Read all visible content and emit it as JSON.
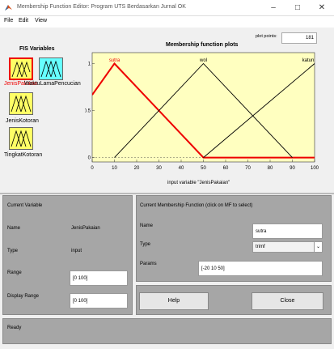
{
  "window": {
    "title": "Membership Function Editor: Program UTS Berdasarkan Jurnal OK"
  },
  "menu": [
    "File",
    "Edit",
    "View"
  ],
  "fis_variables": {
    "title": "FIS Variables",
    "items": [
      {
        "label": "JenisPakaian",
        "type": "input",
        "selected": true
      },
      {
        "label": "WaktuLamaPencucian",
        "type": "output",
        "selected": false
      },
      {
        "label": "JenisKotoran",
        "type": "input",
        "selected": false
      },
      {
        "label": "TingkatKotoran",
        "type": "input",
        "selected": false
      }
    ]
  },
  "plot": {
    "title": "Membership function plots",
    "plot_points_label": "plot points:",
    "plot_points_value": "181"
  },
  "chart_data": {
    "type": "line",
    "xlabel": "input variable \"JenisPakaian\"",
    "xlim": [
      0,
      100
    ],
    "ylim": [
      0,
      1
    ],
    "xticks": [
      0,
      10,
      20,
      30,
      40,
      50,
      60,
      70,
      80,
      90,
      100
    ],
    "yticks": [
      0,
      0.5,
      1
    ],
    "series": [
      {
        "name": "sutra",
        "selected": true,
        "color": "#ee0000",
        "points": [
          [
            0,
            0.667
          ],
          [
            10,
            1
          ],
          [
            50,
            0
          ],
          [
            100,
            0
          ]
        ]
      },
      {
        "name": "wol",
        "selected": false,
        "color": "#000000",
        "points": [
          [
            10,
            0
          ],
          [
            50,
            1
          ],
          [
            90,
            0
          ]
        ]
      },
      {
        "name": "katun",
        "selected": false,
        "color": "#000000",
        "points": [
          [
            50,
            0
          ],
          [
            100,
            1
          ]
        ]
      }
    ]
  },
  "current_variable": {
    "title": "Current Variable",
    "name_label": "Name",
    "name_value": "JenisPakaian",
    "type_label": "Type",
    "type_value": "input",
    "range_label": "Range",
    "range_value": "[0 100]",
    "display_range_label": "Display Range",
    "display_range_value": "[0 100]"
  },
  "current_mf": {
    "title": "Current Membership Function (click on MF to select)",
    "name_label": "Name",
    "name_value": "sutra",
    "type_label": "Type",
    "type_value": "trimf",
    "params_label": "Params",
    "params_value": "[-20 10 50]"
  },
  "buttons": {
    "help": "Help",
    "close": "Close"
  },
  "status": "Ready",
  "colors": {
    "plot_bg": "#ffffc0",
    "selected": "#ee0000",
    "output_var": "#66ffff",
    "input_var": "#ffff66"
  }
}
